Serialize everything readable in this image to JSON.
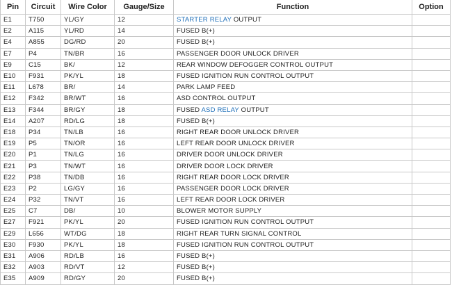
{
  "headers": {
    "pin": "Pin",
    "circuit": "Circuit",
    "wire_color": "Wire Color",
    "gauge": "Gauge/Size",
    "function": "Function",
    "option": "Option"
  },
  "colors": {
    "link": "#1f6fb9",
    "border": "#c8c8c8"
  },
  "rows": [
    {
      "pin": "E1",
      "circuit": "T750",
      "wire": "YL/GY",
      "gauge": "12",
      "fn_link": "STARTER RELAY",
      "fn_text": " OUTPUT",
      "option": ""
    },
    {
      "pin": "E2",
      "circuit": "A115",
      "wire": "YL/RD",
      "gauge": "14",
      "fn_link": "",
      "fn_text": "FUSED B(+)",
      "option": ""
    },
    {
      "pin": "E4",
      "circuit": "A855",
      "wire": "DG/RD",
      "gauge": "20",
      "fn_link": "",
      "fn_text": "FUSED B(+)",
      "option": ""
    },
    {
      "pin": "E7",
      "circuit": "P4",
      "wire": "TN/BR",
      "gauge": "16",
      "fn_link": "",
      "fn_text": "PASSENGER DOOR UNLOCK DRIVER",
      "option": ""
    },
    {
      "pin": "E9",
      "circuit": "C15",
      "wire": "BK/",
      "gauge": "12",
      "fn_link": "",
      "fn_text": "REAR WINDOW DEFOGGER CONTROL OUTPUT",
      "option": ""
    },
    {
      "pin": "E10",
      "circuit": "F931",
      "wire": "PK/YL",
      "gauge": "18",
      "fn_link": "",
      "fn_text": "FUSED IGNITION RUN CONTROL OUTPUT",
      "option": ""
    },
    {
      "pin": "E11",
      "circuit": "L678",
      "wire": "BR/",
      "gauge": "14",
      "fn_link": "",
      "fn_text": "PARK LAMP FEED",
      "option": ""
    },
    {
      "pin": "E12",
      "circuit": "F342",
      "wire": "BR/WT",
      "gauge": "16",
      "fn_link": "",
      "fn_text": "ASD CONTROL OUTPUT",
      "option": ""
    },
    {
      "pin": "E13",
      "circuit": "F344",
      "wire": "BR/GY",
      "gauge": "18",
      "fn_pre": "FUSED ",
      "fn_link": "ASD RELAY",
      "fn_text": " OUTPUT",
      "option": ""
    },
    {
      "pin": "E14",
      "circuit": "A207",
      "wire": "RD/LG",
      "gauge": "18",
      "fn_link": "",
      "fn_text": "FUSED B(+)",
      "option": ""
    },
    {
      "pin": "E18",
      "circuit": "P34",
      "wire": "TN/LB",
      "gauge": "16",
      "fn_link": "",
      "fn_text": "RIGHT REAR DOOR UNLOCK DRIVER",
      "option": ""
    },
    {
      "pin": "E19",
      "circuit": "P5",
      "wire": "TN/OR",
      "gauge": "16",
      "fn_link": "",
      "fn_text": "LEFT REAR DOOR UNLOCK DRIVER",
      "option": ""
    },
    {
      "pin": "E20",
      "circuit": "P1",
      "wire": "TN/LG",
      "gauge": "16",
      "fn_link": "",
      "fn_text": "DRIVER DOOR UNLOCK DRIVER",
      "option": ""
    },
    {
      "pin": "E21",
      "circuit": "P3",
      "wire": "TN/WT",
      "gauge": "16",
      "fn_link": "",
      "fn_text": "DRIVER DOOR LOCK DRIVER",
      "option": ""
    },
    {
      "pin": "E22",
      "circuit": "P38",
      "wire": "TN/DB",
      "gauge": "16",
      "fn_link": "",
      "fn_text": "RIGHT REAR DOOR LOCK DRIVER",
      "option": ""
    },
    {
      "pin": "E23",
      "circuit": "P2",
      "wire": "LG/GY",
      "gauge": "16",
      "fn_link": "",
      "fn_text": "PASSENGER DOOR LOCK DRIVER",
      "option": ""
    },
    {
      "pin": "E24",
      "circuit": "P32",
      "wire": "TN/VT",
      "gauge": "16",
      "fn_link": "",
      "fn_text": "LEFT REAR DOOR LOCK DRIVER",
      "option": ""
    },
    {
      "pin": "E25",
      "circuit": "C7",
      "wire": "DB/",
      "gauge": "10",
      "fn_link": "",
      "fn_text": "BLOWER MOTOR SUPPLY",
      "option": ""
    },
    {
      "pin": "E27",
      "circuit": "F921",
      "wire": "PK/YL",
      "gauge": "20",
      "fn_link": "",
      "fn_text": "FUSED IGNITION RUN CONTROL OUTPUT",
      "option": ""
    },
    {
      "pin": "E29",
      "circuit": "L656",
      "wire": "WT/DG",
      "gauge": "18",
      "fn_link": "",
      "fn_text": "RIGHT REAR TURN SIGNAL CONTROL",
      "option": ""
    },
    {
      "pin": "E30",
      "circuit": "F930",
      "wire": "PK/YL",
      "gauge": "18",
      "fn_link": "",
      "fn_text": "FUSED IGNITION RUN CONTROL OUTPUT",
      "option": ""
    },
    {
      "pin": "E31",
      "circuit": "A906",
      "wire": "RD/LB",
      "gauge": "16",
      "fn_link": "",
      "fn_text": "FUSED B(+)",
      "option": ""
    },
    {
      "pin": "E32",
      "circuit": "A903",
      "wire": "RD/VT",
      "gauge": "12",
      "fn_link": "",
      "fn_text": "FUSED B(+)",
      "option": ""
    },
    {
      "pin": "E35",
      "circuit": "A909",
      "wire": "RD/GY",
      "gauge": "20",
      "fn_link": "",
      "fn_text": "FUSED B(+)",
      "option": ""
    }
  ]
}
